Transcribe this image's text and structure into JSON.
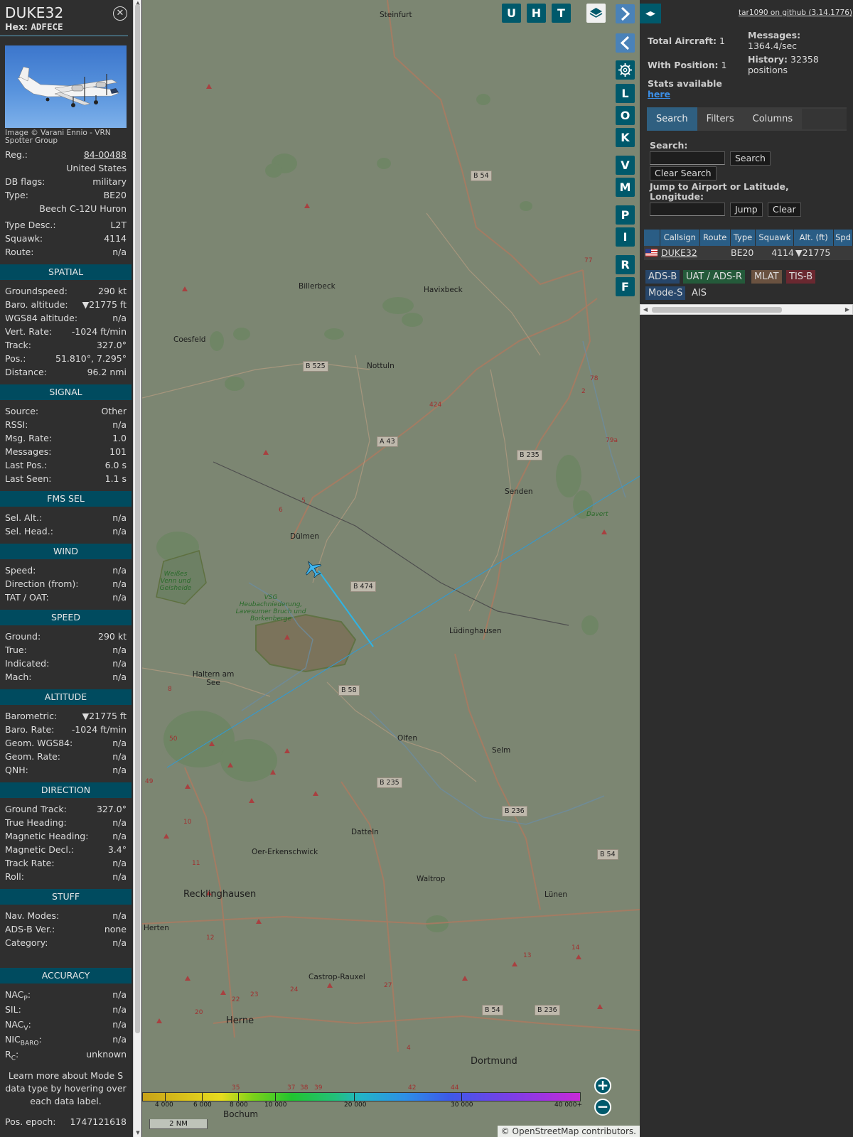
{
  "aircraft": {
    "callsign": "DUKE32",
    "hex_label": "Hex:",
    "hex": "ADFECE",
    "image_credit": "Image © Varani Ennio - VRN Spotter Group",
    "reg_label": "Reg.:",
    "reg": "84-00488",
    "country": "United States",
    "dbflags_label": "DB flags:",
    "dbflags": "military",
    "type_label": "Type:",
    "type": "BE20",
    "type_full": "Beech C-12U Huron",
    "typedesc_label": "Type Desc.:",
    "typedesc": "L2T",
    "squawk_label": "Squawk:",
    "squawk": "4114",
    "route_label": "Route:",
    "route": "n/a"
  },
  "sections": {
    "spatial": "SPATIAL",
    "signal": "SIGNAL",
    "fms": "FMS SEL",
    "wind": "WIND",
    "speed": "SPEED",
    "altitude": "ALTITUDE",
    "direction": "DIRECTION",
    "stuff": "STUFF",
    "accuracy": "ACCURACY"
  },
  "spatial": [
    {
      "label": "Groundspeed:",
      "value": "290 kt"
    },
    {
      "label": "Baro. altitude:",
      "value": "▼21775 ft"
    },
    {
      "label": "WGS84 altitude:",
      "value": "n/a"
    },
    {
      "label": "Vert. Rate:",
      "value": "-1024 ft/min"
    },
    {
      "label": "Track:",
      "value": "327.0°"
    },
    {
      "label": "Pos.:",
      "value": "51.810°, 7.295°"
    },
    {
      "label": "Distance:",
      "value": "96.2 nmi"
    }
  ],
  "signal": [
    {
      "label": "Source:",
      "value": "Other"
    },
    {
      "label": "RSSI:",
      "value": "n/a"
    },
    {
      "label": "Msg. Rate:",
      "value": "1.0"
    },
    {
      "label": "Messages:",
      "value": "101"
    },
    {
      "label": "Last Pos.:",
      "value": "6.0 s"
    },
    {
      "label": "Last Seen:",
      "value": "1.1 s"
    }
  ],
  "fms": [
    {
      "label": "Sel. Alt.:",
      "value": "n/a"
    },
    {
      "label": "Sel. Head.:",
      "value": "n/a"
    }
  ],
  "wind": [
    {
      "label": "Speed:",
      "value": "n/a"
    },
    {
      "label": "Direction (from):",
      "value": "n/a"
    },
    {
      "label": "TAT / OAT:",
      "value": "n/a"
    }
  ],
  "speed": [
    {
      "label": "Ground:",
      "value": "290 kt"
    },
    {
      "label": "True:",
      "value": "n/a"
    },
    {
      "label": "Indicated:",
      "value": "n/a"
    },
    {
      "label": "Mach:",
      "value": "n/a"
    }
  ],
  "altitude": [
    {
      "label": "Barometric:",
      "value": "▼21775 ft"
    },
    {
      "label": "Baro. Rate:",
      "value": "-1024 ft/min"
    },
    {
      "label": "Geom. WGS84:",
      "value": "n/a"
    },
    {
      "label": "Geom. Rate:",
      "value": "n/a"
    },
    {
      "label": "QNH:",
      "value": "n/a"
    }
  ],
  "direction": [
    {
      "label": "Ground Track:",
      "value": "327.0°"
    },
    {
      "label": "True Heading:",
      "value": "n/a"
    },
    {
      "label": "Magnetic Heading:",
      "value": "n/a"
    },
    {
      "label": "Magnetic Decl.:",
      "value": "3.4°"
    },
    {
      "label": "Track Rate:",
      "value": "n/a"
    },
    {
      "label": "Roll:",
      "value": "n/a"
    }
  ],
  "stuff": [
    {
      "label": "Nav. Modes:",
      "value": "n/a"
    },
    {
      "label": "ADS-B Ver.:",
      "value": "none"
    },
    {
      "label": "Category:",
      "value": "n/a"
    }
  ],
  "accuracy": [
    {
      "label": "NAC",
      "sub": "P",
      "value": "n/a"
    },
    {
      "label": "SIL:",
      "sub": "",
      "value": "n/a"
    },
    {
      "label": "NAC",
      "sub": "V",
      "value": "n/a"
    },
    {
      "label": "NIC",
      "sub": "BARO",
      "value": "n/a"
    },
    {
      "label": "R",
      "sub": "C",
      "value": "unknown"
    }
  ],
  "learn_more": "Learn more about Mode S data type by hovering over each data label.",
  "pos_epoch_label": "Pos. epoch:",
  "pos_epoch": "1747121618",
  "map_buttons": {
    "top": [
      "U",
      "H",
      "T"
    ],
    "side": [
      "L",
      "O",
      "K",
      "V",
      "M",
      "P",
      "I",
      "R",
      "F"
    ]
  },
  "map_labels": {
    "towns": [
      "Steinfurt",
      "Billerbeck",
      "Havixbeck",
      "Coesfeld",
      "Nottuln",
      "Senden",
      "Dülmen",
      "Lüdinghausen",
      "Haltern am See",
      "Olfen",
      "Selm",
      "Datteln",
      "Oer-Erkenschwick",
      "Waltrop",
      "Lünen",
      "Herten",
      "Castrop-Rauxel",
      "Davert"
    ],
    "big_towns": [
      "Recklinghausen",
      "Herne",
      "Dortmund",
      "Bochum"
    ],
    "roads": [
      "B 54",
      "B 525",
      "A 43",
      "B 235",
      "B 474",
      "B 58",
      "B 235",
      "B 236",
      "B 54",
      "B 54",
      "B 236"
    ],
    "nature": [
      "Weißes Venn und Geisheide",
      "VSG Heubachniederung, Lavesumer Bruch und Borkenberge"
    ],
    "road_numbers": [
      "77",
      "78",
      "2",
      "79a",
      "5",
      "6",
      "424",
      "8",
      "50",
      "49",
      "10",
      "11",
      "12",
      "13",
      "14",
      "27",
      "24",
      "23",
      "20",
      "22",
      "35",
      "37",
      "38",
      "39",
      "42",
      "44",
      "4"
    ]
  },
  "colorbar_ticks": [
    "4 000",
    "6 000",
    "8 000",
    "10 000",
    "20 000",
    "30 000",
    "40 000+"
  ],
  "scale_label": "2 NM",
  "osm": "© OpenStreetMap contributors.",
  "panel": {
    "github": "tar1090 on github (3.14.1776)",
    "total_aircraft_label": "Total Aircraft:",
    "total_aircraft": "1",
    "with_position_label": "With Position:",
    "with_position": "1",
    "messages_label": "Messages:",
    "messages": "1364.4/sec",
    "history_label": "History:",
    "history": "32358 positions",
    "stats_label": "Stats available",
    "stats_link": "here",
    "tabs": [
      "Search",
      "Filters",
      "Columns"
    ],
    "search_label": "Search:",
    "search_button": "Search",
    "clear_search_button": "Clear Search",
    "jump_label": "Jump to Airport or Latitude, Longitude:",
    "jump_button": "Jump",
    "clear_button": "Clear",
    "columns": [
      "Callsign",
      "Route",
      "Type",
      "Squawk",
      "Alt. (ft)",
      "Spd"
    ],
    "row": {
      "callsign": "DUKE32",
      "route": "",
      "type": "BE20",
      "squawk": "4114",
      "alt": "▼21775"
    },
    "sources": [
      "ADS-B",
      "UAT / ADS-R",
      "MLAT",
      "TIS-B",
      "Mode-S",
      "AIS"
    ],
    "source_colors": [
      "#27466a",
      "#245a3a",
      "#6a5240",
      "#6a2830",
      "#27466a",
      "#2d2d2d"
    ]
  }
}
